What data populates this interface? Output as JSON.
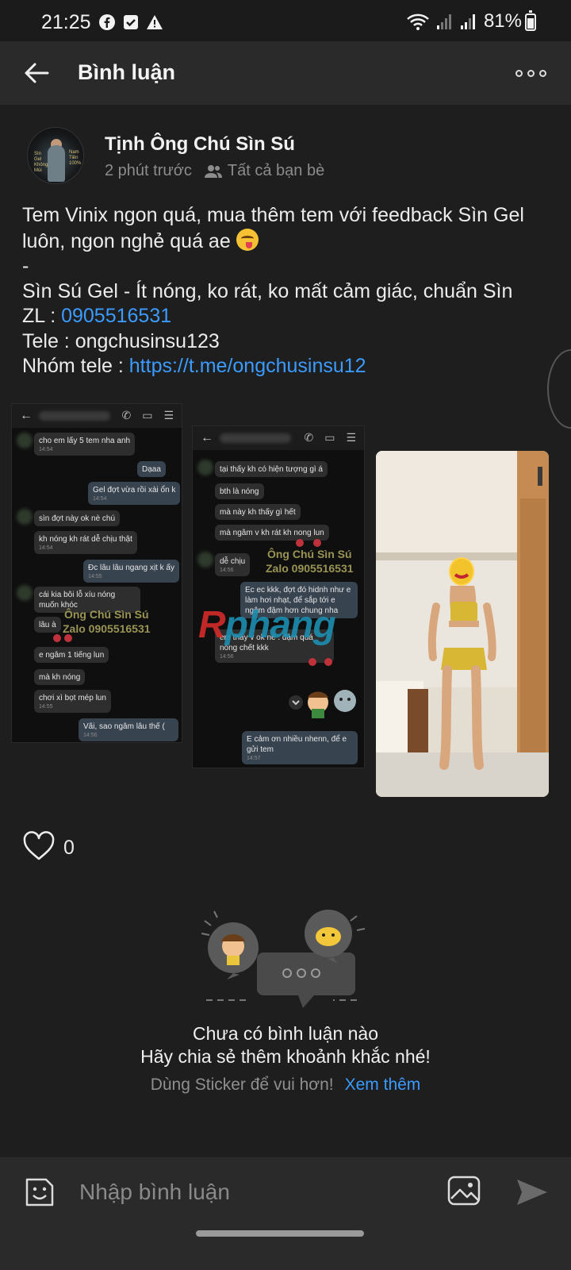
{
  "status_bar": {
    "time": "21:25",
    "battery": "81%",
    "icons": [
      "facebook-icon",
      "check-box-icon",
      "warning-icon",
      "wifi-icon",
      "signal-icon",
      "signal-icon",
      "battery-icon"
    ]
  },
  "header": {
    "title": "Bình luận",
    "back_icon": "arrow-left-icon",
    "more_icon": "more-icon"
  },
  "post": {
    "author": "Tịnh Ông Chú Sìn Sú",
    "time": "2 phút trước",
    "audience": "Tất cả bạn bè",
    "body": {
      "line1": "Tem Vinix ngon quá, mua thêm tem với feedback Sìn Gel",
      "line2": "luôn, ngon nghẻ quá ae",
      "line3": "-",
      "line4": "Sìn Sú Gel - Ít nóng, ko rát, ko mất cảm giác, chuẩn Sìn",
      "zl_label": "ZL : ",
      "zl_phone": "0905516531",
      "tele": "Tele : ongchusinsu123",
      "group_label": "Nhóm tele : ",
      "group_link": "https://t.me/ongchusinsu12"
    },
    "screenshot1": {
      "messages": [
        {
          "text": "cho em lấy 5 tem nha anh",
          "time": "14:54",
          "side": "in"
        },
        {
          "text": "Dạaa",
          "time": "",
          "side": "out"
        },
        {
          "text": "Gel đợt vừa rồi xài ổn k",
          "time": "14:54",
          "side": "out"
        },
        {
          "text": "sìn đợt này ok nè chú",
          "time": "",
          "side": "in"
        },
        {
          "text": "kh nóng kh rát dễ chịu thật",
          "time": "14:54",
          "side": "in"
        },
        {
          "text": "Đc lâu lâu ngang xịt k ấy",
          "time": "14:55",
          "side": "out"
        },
        {
          "text": "cái kia bôi lỗ xíu nóng muốn khóc",
          "time": "",
          "side": "in"
        },
        {
          "text": "lâu à",
          "time": "",
          "side": "in"
        },
        {
          "text": "e ngâm 1 tiếng lun",
          "time": "",
          "side": "in"
        },
        {
          "text": "mà kh nóng",
          "time": "",
          "side": "in"
        },
        {
          "text": "chơi xì bọt mép lun",
          "time": "14:55",
          "side": "in"
        },
        {
          "text": "Vãi, sao ngâm lâu thế (",
          "time": "14:56",
          "side": "out"
        }
      ],
      "watermark_line1": "Ông Chú Sìn Sú",
      "watermark_line2": "Zalo 0905516531"
    },
    "screenshot2": {
      "messages": [
        {
          "text": "tại thấy kh có hiện tượng gì á",
          "time": "",
          "side": "in"
        },
        {
          "text": "bth là nóng",
          "time": "",
          "side": "in"
        },
        {
          "text": "mà này kh thấy gì hết",
          "time": "",
          "side": "in"
        },
        {
          "text": "mà ngâm v kh rát kh nong lun",
          "time": "",
          "side": "in"
        },
        {
          "text": "dễ chịu",
          "time": "14:56",
          "side": "in"
        },
        {
          "text": "Ec ec kkk, đợt đó hidnh như e làm hơi nhạt, để sắp tới e ngâm đậm hơn chung nha",
          "time": "",
          "side": "out"
        },
        {
          "text": "em thấy v ok nè . đậm quá nóng chết kkk",
          "time": "14:56",
          "side": "in"
        },
        {
          "text": "E cảm ơn nhiều nhenn, để e gửi tem",
          "time": "14:57",
          "side": "out"
        }
      ],
      "watermark_line1": "Ông Chú Sìn Sú",
      "watermark_line2": "Zalo 0905516531"
    },
    "overlay_logo": {
      "r": "R",
      "rest": "phang"
    },
    "reactions": {
      "like_count": "0"
    }
  },
  "comments": {
    "empty_title_1": "Chưa có bình luận nào",
    "empty_title_2": "Hãy chia sẻ thêm khoảnh khắc nhé!",
    "hint": "Dùng Sticker để vui hơn!",
    "see_more": "Xem thêm"
  },
  "composer": {
    "placeholder": "Nhập bình luận"
  },
  "colors": {
    "background": "#1e1e1e",
    "header": "#2a2a2a",
    "link": "#3b9bff"
  }
}
